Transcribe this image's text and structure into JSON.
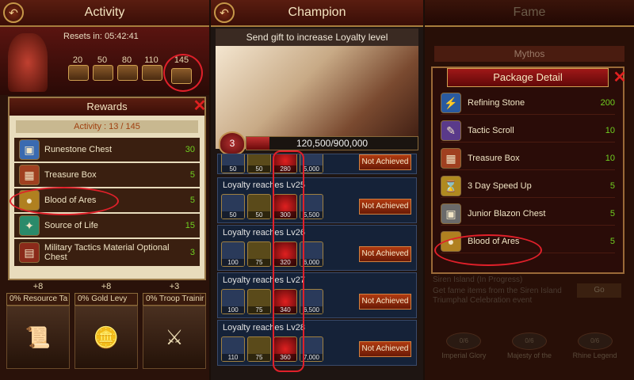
{
  "activity": {
    "title": "Activity",
    "resets_label": "Resets in:",
    "resets_time": "05:42:41",
    "milestones": [
      "20",
      "50",
      "80",
      "110",
      "145"
    ],
    "rewards": {
      "title": "Rewards",
      "progress": "Activity : 13 / 145",
      "items": [
        {
          "name": "Runestone Chest",
          "count": "30"
        },
        {
          "name": "Treasure Box",
          "count": "5"
        },
        {
          "name": "Blood of Ares",
          "count": "5"
        },
        {
          "name": "Source of Life",
          "count": "15"
        },
        {
          "name": "Military Tactics Material Optional Chest",
          "count": "3"
        }
      ]
    },
    "upgrades": [
      {
        "plus": "+8",
        "label": "0% Resource Ta"
      },
      {
        "plus": "+8",
        "label": "0% Gold Levy"
      },
      {
        "plus": "+3",
        "label": "0% Troop Trainir"
      }
    ]
  },
  "champion": {
    "title": "Champion",
    "gift_header": "Send gift to increase Loyalty level",
    "heart_level": "3",
    "loyalty_value": "120,500/900,000",
    "loyalty_fraction": 0.134,
    "rows": [
      {
        "title": "Loyalty reaches Lv25",
        "items": [
          "50",
          "50",
          "300",
          "5,500"
        ],
        "status": "Not Achieved"
      },
      {
        "title": "Loyalty reaches Lv26",
        "items": [
          "100",
          "75",
          "320",
          "6,000"
        ],
        "status": "Not Achieved"
      },
      {
        "title": "Loyalty reaches Lv27",
        "items": [
          "100",
          "75",
          "340",
          "6,500"
        ],
        "status": "Not Achieved"
      },
      {
        "title": "Loyalty reaches Lv28",
        "items": [
          "110",
          "75",
          "360",
          "7,000"
        ],
        "status": "Not Achieved"
      }
    ],
    "partial_row": {
      "items": [
        "50",
        "50",
        "280",
        "5,000"
      ],
      "status": "Not Achieved"
    }
  },
  "fame": {
    "title": "Fame",
    "mythos": "Mythos",
    "package": {
      "title": "Package Detail",
      "items": [
        {
          "name": "Refining Stone",
          "count": "200"
        },
        {
          "name": "Tactic Scroll",
          "count": "10"
        },
        {
          "name": "Treasure Box",
          "count": "10"
        },
        {
          "name": "3 Day Speed Up",
          "count": "5"
        },
        {
          "name": "Junior Blazon Chest",
          "count": "5"
        },
        {
          "name": "Blood of Ares",
          "count": "5"
        }
      ]
    },
    "bg_line1": "Siren Island (In Progress)",
    "bg_line2": "Get fame items from the Siren Island",
    "bg_line3": "Triumphal Celebration event",
    "go": "Go",
    "bottom_counts": [
      "0/6",
      "0/6",
      "0/6"
    ],
    "bottom_labels": [
      "Imperial Glory",
      "Majesty of the",
      "Rhine Legend"
    ]
  }
}
